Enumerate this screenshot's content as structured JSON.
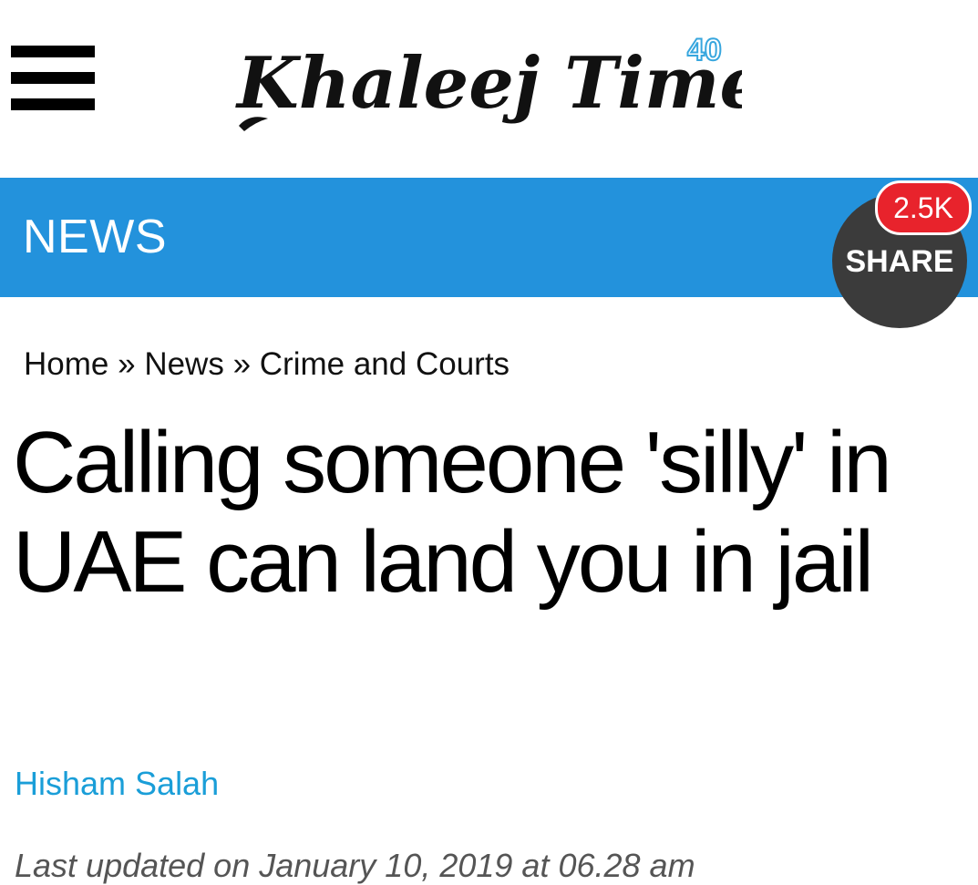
{
  "header": {
    "menu_icon": "hamburger-menu-icon",
    "logo_text": "Khaleej Times",
    "logo_badge": "40"
  },
  "navbar": {
    "section_title": "NEWS",
    "share_label": "SHARE",
    "share_count": "2.5K",
    "colors": {
      "bar": "#2392dc",
      "share_button": "#3b3b3b",
      "count_badge": "#e8232c"
    }
  },
  "breadcrumb": {
    "items": [
      "Home",
      "News",
      "Crime and Courts"
    ],
    "separator": "»"
  },
  "article": {
    "headline": "Calling someone 'silly' in UAE can land you in jail",
    "author": "Hisham Salah",
    "updated": "Last updated on January 10, 2019 at 06.28 am"
  }
}
